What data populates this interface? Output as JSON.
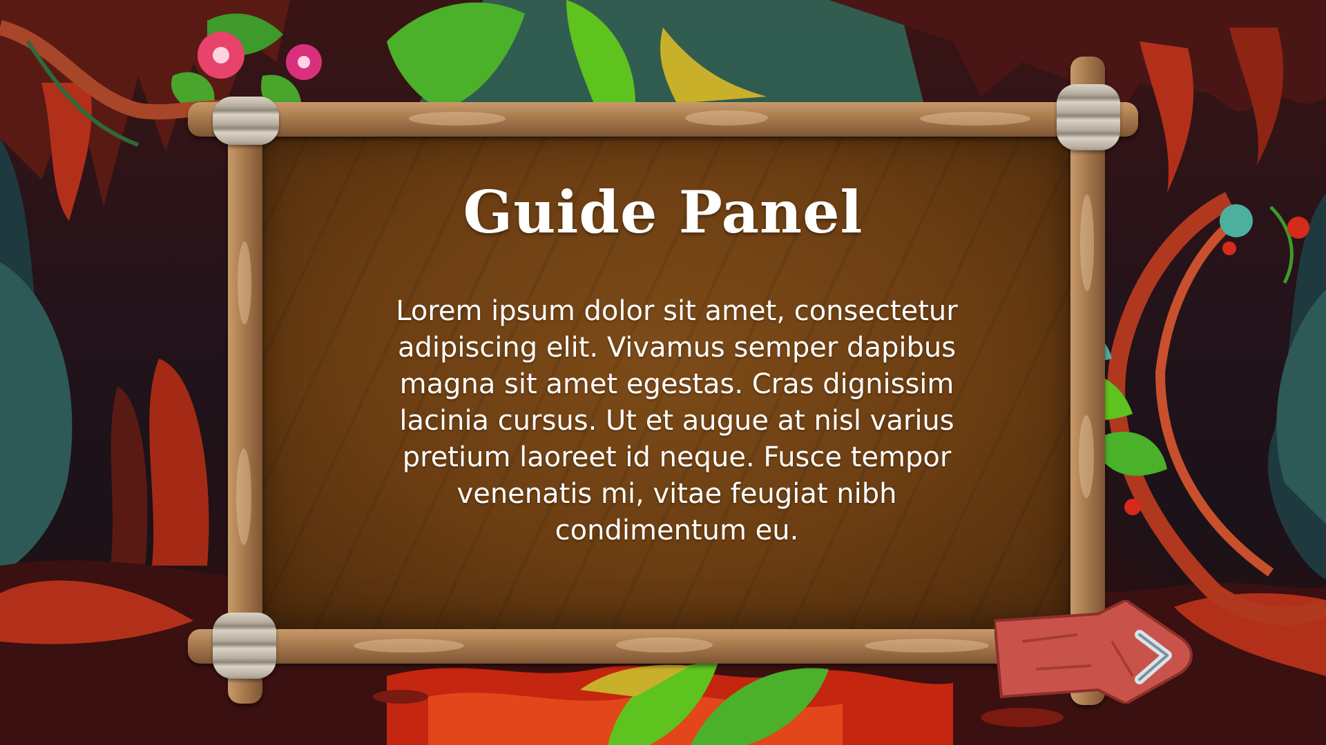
{
  "panel": {
    "title": "Guide Panel",
    "body": "Lorem ipsum dolor sit amet, consectetur adipiscing elit. Vivamus semper dapibus magna sit amet egestas. Cras dignissim lacinia cursus. Ut et augue at nisl varius pretium laoreet id neque. Fusce tempor venenatis mi, vitae feugiat nibh condimentum eu."
  },
  "icons": {
    "next": "arrow-right-sign-icon",
    "flower": "pink-flower-icon",
    "vine": "vine-icon"
  },
  "colors": {
    "board": "#6a3d12",
    "frame": "#a97a4d",
    "lava": "#c4260f",
    "leaf": "#5ec21f",
    "arrow": "#c9534a"
  }
}
